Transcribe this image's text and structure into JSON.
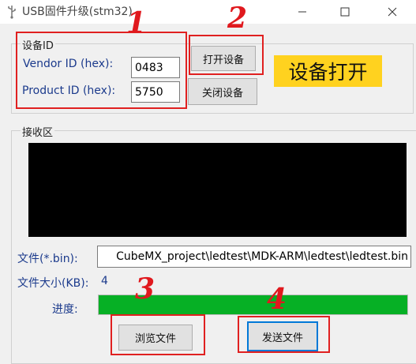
{
  "window": {
    "title": "USB固件升级(stm32)",
    "controls": [
      "minimize-icon",
      "maximize-icon",
      "close-icon"
    ]
  },
  "device": {
    "group_label": "设备ID",
    "vendor_label": "Vendor ID  (hex):",
    "vendor_value": "0483",
    "product_label": "Product ID  (hex):",
    "product_value": "5750",
    "open_button": "打开设备",
    "close_button": "关闭设备",
    "status_text": "设备打开"
  },
  "receive": {
    "group_label": "接收区"
  },
  "file": {
    "path_label": "文件(*.bin):",
    "path_value": "CubeMX_project\\ledtest\\MDK-ARM\\ledtest\\ledtest.bin",
    "size_label": "文件大小(KB):",
    "size_value": "4",
    "progress_label": "进度:",
    "progress": 1.0,
    "browse_button": "浏览文件",
    "send_button": "发送文件"
  },
  "annotations": [
    "1",
    "2",
    "3",
    "4"
  ],
  "colors": {
    "status_bg": "#ffd21f",
    "progress_fill": "#06b025",
    "annotation_red": "#e0191e",
    "focus_blue": "#0078d7"
  }
}
